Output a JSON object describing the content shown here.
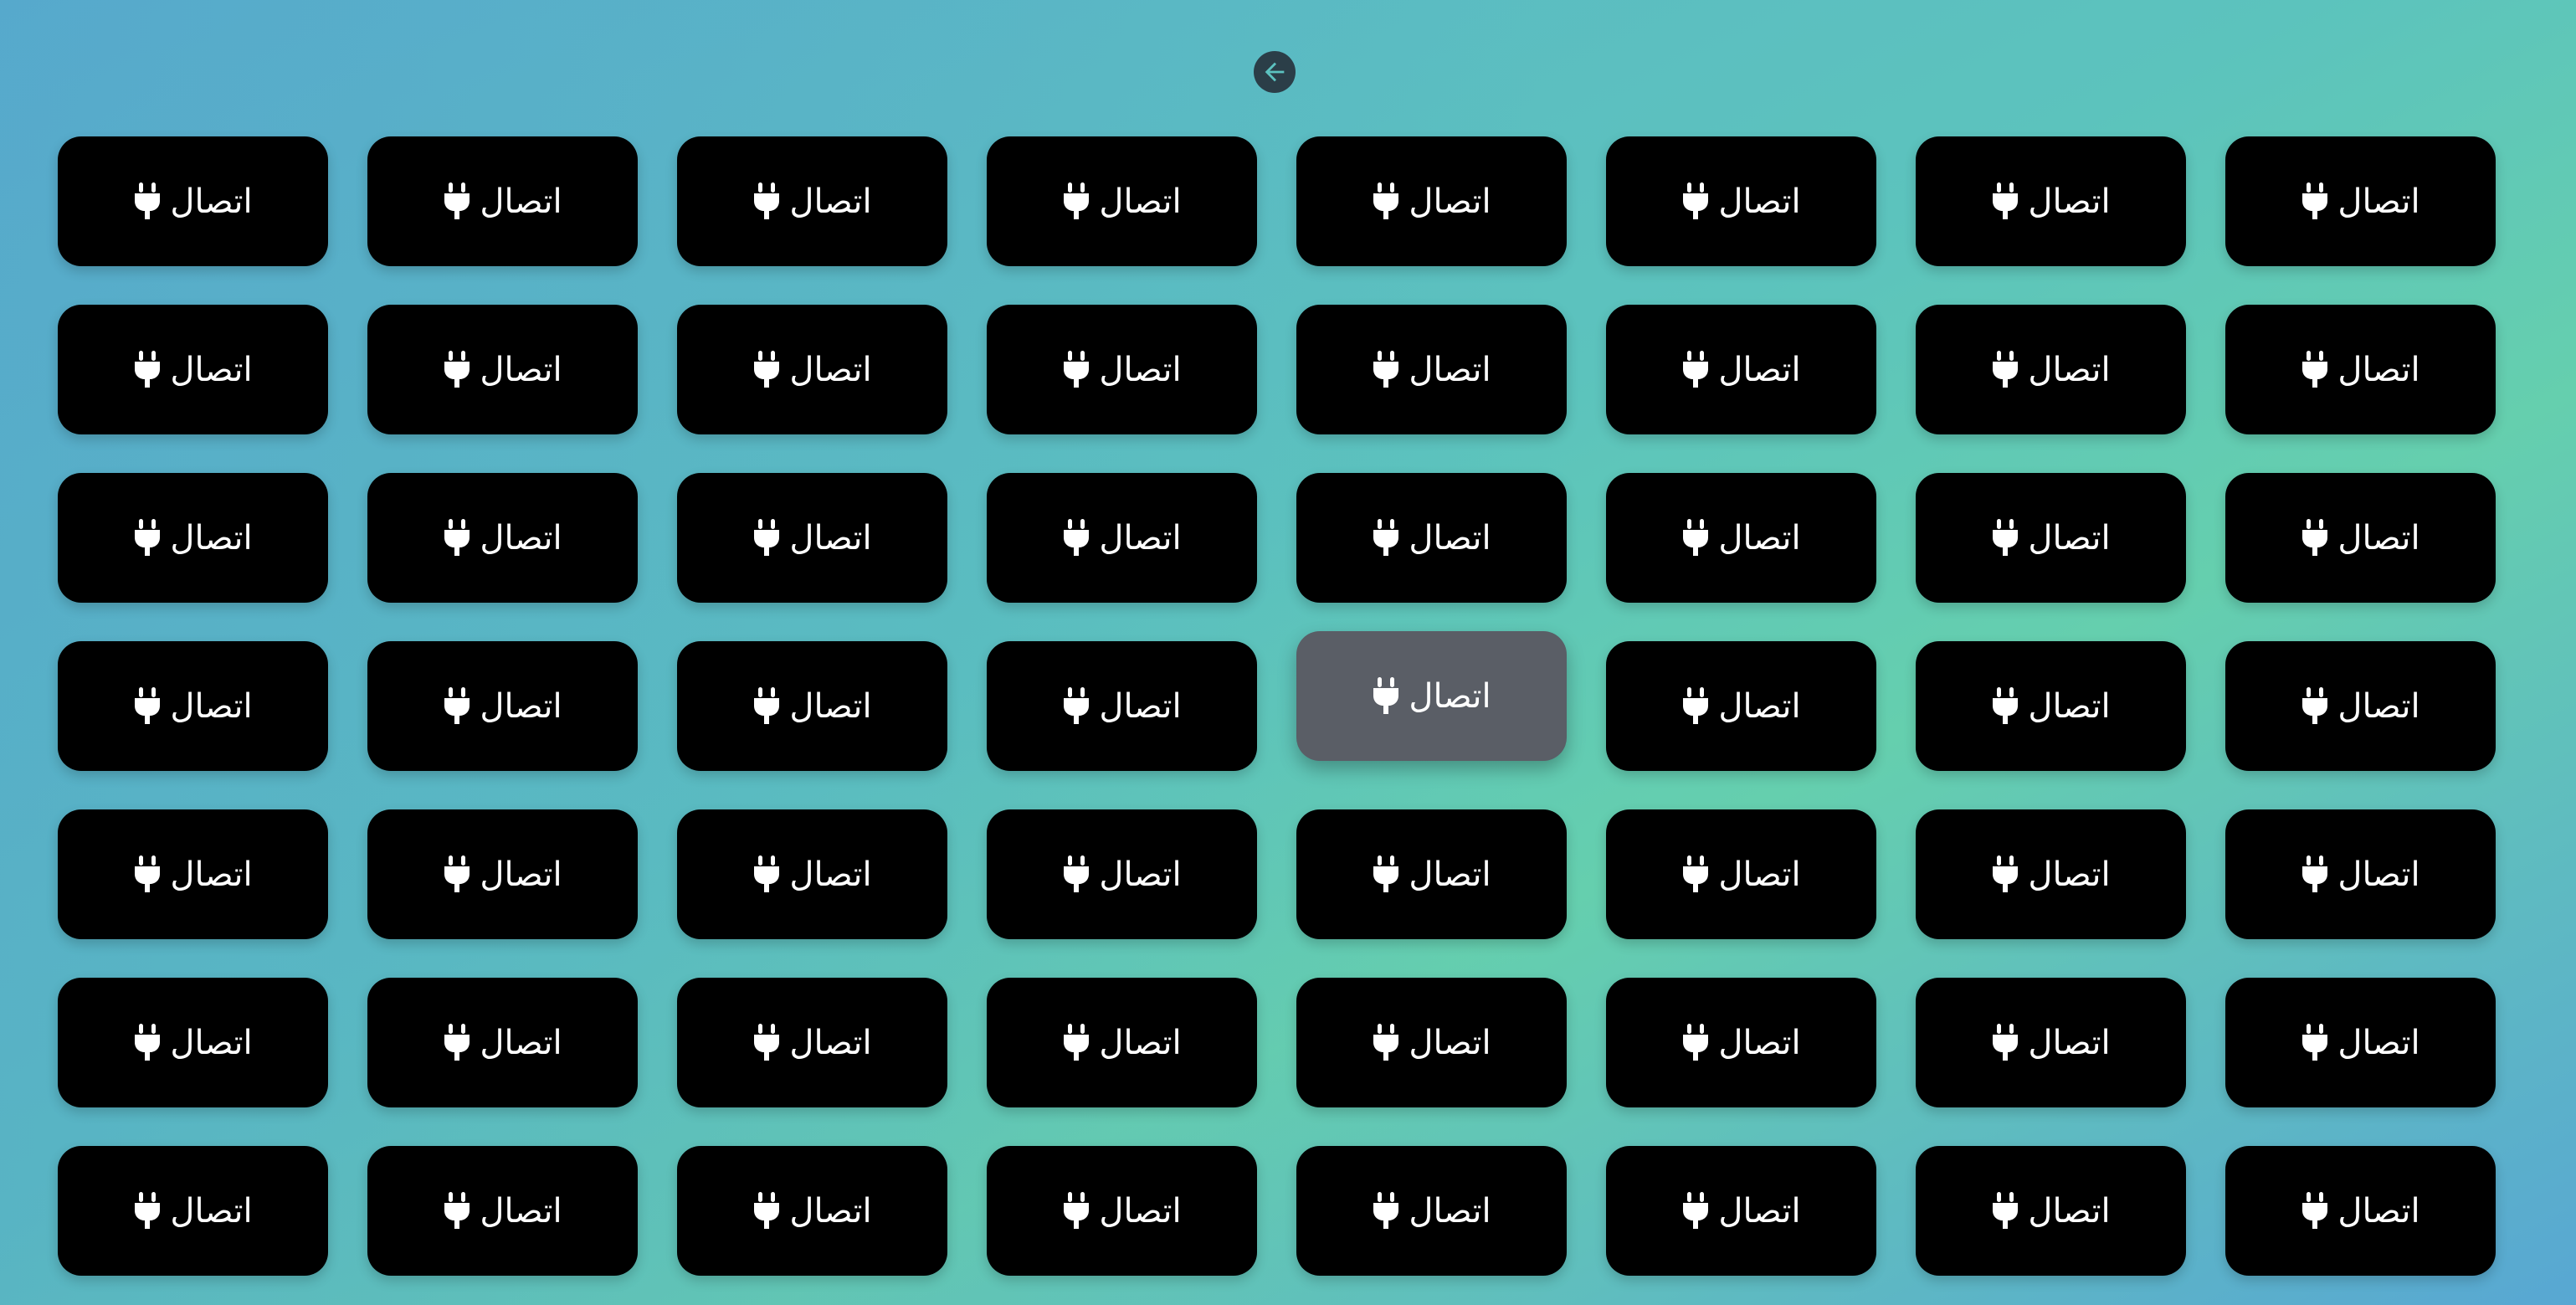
{
  "back_button": {
    "icon": "arrow-left-icon"
  },
  "button": {
    "label": "اتصال",
    "icon": "plug-icon"
  },
  "grid": {
    "rows": 7,
    "columns": 8,
    "hovered_index": 28
  },
  "colors": {
    "button_bg": "#000000",
    "button_hover_bg": "#5a5e66",
    "button_text": "#ffffff",
    "back_button_bg": "#2b3e48"
  }
}
